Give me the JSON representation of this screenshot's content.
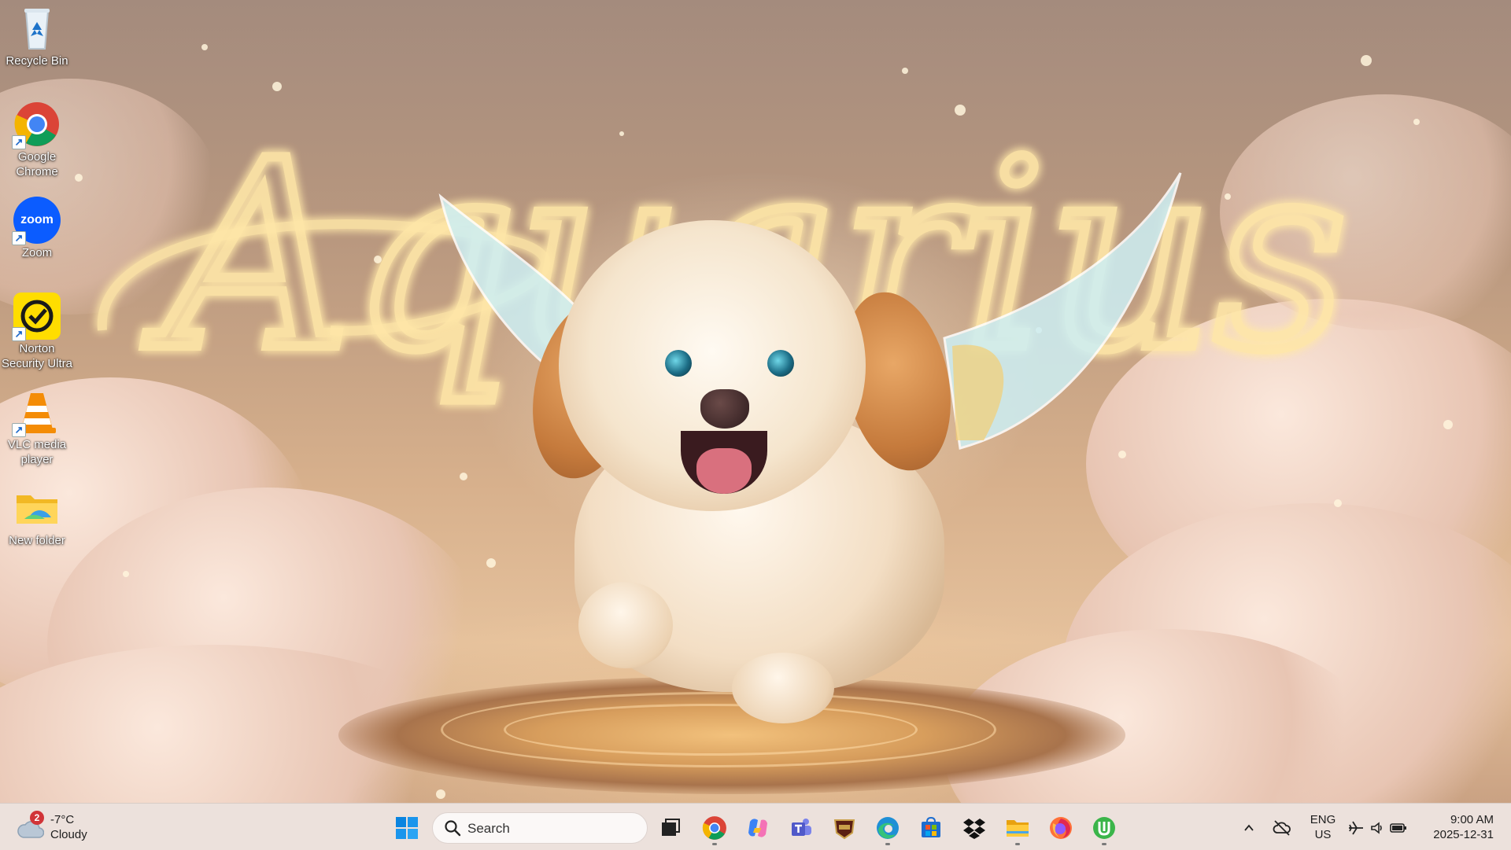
{
  "desktop": {
    "icons": [
      {
        "label": "Recycle Bin",
        "icon": "recycle-bin-icon"
      },
      {
        "label": "Google Chrome",
        "icon": "chrome-icon"
      },
      {
        "label": "Zoom",
        "icon": "zoom-icon",
        "badge_text": "zoom"
      },
      {
        "label": "Norton Security Ultra",
        "icon": "norton-icon"
      },
      {
        "label": "VLC media player",
        "icon": "vlc-icon"
      },
      {
        "label": "New folder",
        "icon": "folder-icon"
      }
    ]
  },
  "wallpaper": {
    "text": "Aquarius"
  },
  "taskbar": {
    "weather": {
      "temp": "-7°C",
      "condition": "Cloudy",
      "badge": "2"
    },
    "search": {
      "placeholder": "Search"
    },
    "apps": [
      "start-icon",
      "task-view-icon",
      "chrome-icon",
      "copilot-icon",
      "teams-icon",
      "game-icon",
      "edge-icon",
      "store-icon",
      "dropbox-icon",
      "file-explorer-icon",
      "firefox-icon",
      "utorrent-icon"
    ],
    "tray": {
      "language_1": "ENG",
      "language_2": "US",
      "time": "9:00 AM",
      "date": "2025-12-31"
    }
  },
  "colors": {
    "accent": "#0078d4",
    "taskbar_bg": "#eee4e0",
    "neon": "#ffe7a8"
  }
}
